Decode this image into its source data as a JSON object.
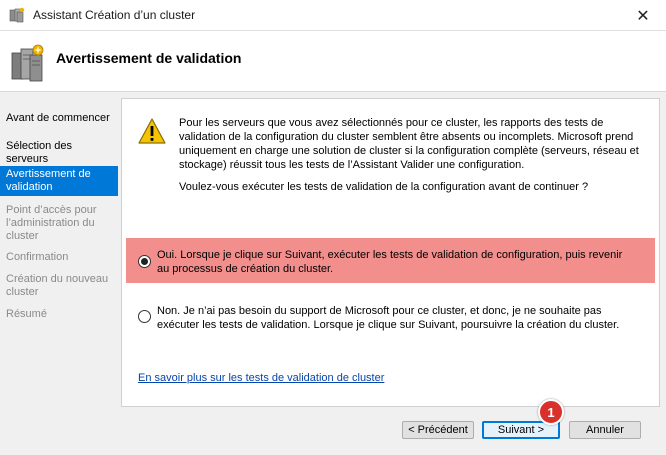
{
  "window": {
    "title": "Assistant Création d’un cluster",
    "close_glyph": "✕"
  },
  "header": {
    "title": "Avertissement de validation"
  },
  "sidebar": {
    "items": [
      {
        "label": "Avant de commencer",
        "state": "done"
      },
      {
        "label": "Sélection des serveurs",
        "state": "done"
      },
      {
        "label": "Avertissement de validation",
        "state": "active"
      },
      {
        "label": "Point d’accès pour l’administration du cluster",
        "state": "disabled"
      },
      {
        "label": "Confirmation",
        "state": "disabled"
      },
      {
        "label": "Création du nouveau cluster",
        "state": "disabled"
      },
      {
        "label": "Résumé",
        "state": "disabled"
      }
    ]
  },
  "content": {
    "paragraph": "Pour les serveurs que vous avez sélectionnés pour ce cluster, les rapports des tests de validation de la configuration du cluster semblent être absents ou incomplets. Microsoft prend uniquement en charge une solution de cluster si la configuration complète (serveurs, réseau et stockage) réussit tous les tests de l’Assistant Valider une configuration.",
    "question": "Voulez-vous exécuter les tests de validation de la configuration avant de continuer ?",
    "options": {
      "yes": {
        "label": "Oui. Lorsque je clique sur Suivant, exécuter les tests de validation de configuration, puis revenir au processus de création du cluster.",
        "selected": true
      },
      "no": {
        "label": "Non. Je n’ai pas besoin du support de Microsoft pour ce cluster, et donc, je ne souhaite pas exécuter les tests de validation. Lorsque je clique sur Suivant, poursuivre la création du cluster.",
        "selected": false
      }
    },
    "help_link": "En savoir plus sur les tests de validation de cluster"
  },
  "buttons": {
    "previous": "< Précédent",
    "next": "Suivant >",
    "cancel": "Annuler"
  },
  "annotation": {
    "badge_number": "1"
  },
  "colors": {
    "accent": "#0078d7",
    "highlight": "#f28e8c",
    "link": "#0645ad",
    "badge": "#d9302b"
  }
}
